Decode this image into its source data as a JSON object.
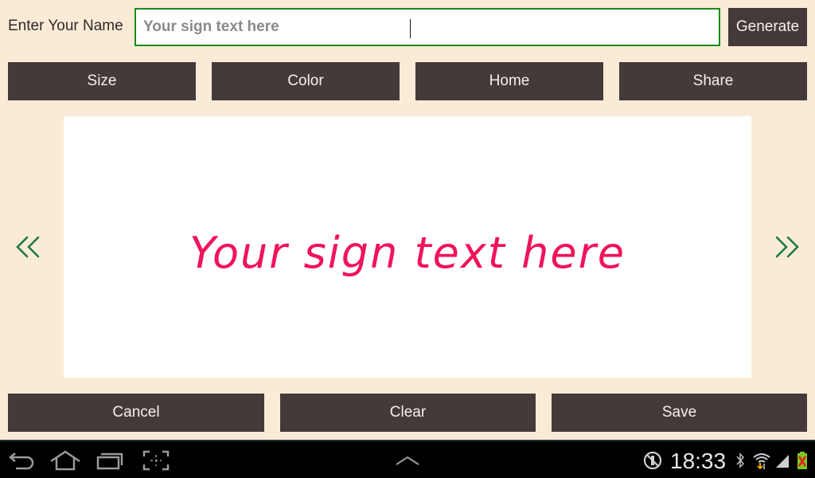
{
  "header": {
    "name_label": "Enter Your Name",
    "name_input_value": "Your sign text here",
    "name_input_placeholder": "Your sign text here",
    "generate_label": "Generate"
  },
  "toolbar": {
    "size_label": "Size",
    "color_label": "Color",
    "home_label": "Home",
    "share_label": "Share"
  },
  "preview": {
    "sign_text": "Your sign text here",
    "sign_color": "#f0145a",
    "prev_icon": "double-chevron-left",
    "next_icon": "double-chevron-right",
    "arrow_color": "#1a7a3a"
  },
  "actions": {
    "cancel_label": "Cancel",
    "clear_label": "Clear",
    "save_label": "Save"
  },
  "system_bar": {
    "back_icon": "back-arrow",
    "home_icon": "home-outline",
    "recents_icon": "recent-apps",
    "screenshot_icon": "screen-capture",
    "up_icon": "chevron-up",
    "clock": "18:33",
    "status_icons": [
      "no-sync",
      "bluetooth",
      "wifi",
      "signal",
      "battery-low"
    ]
  },
  "colors": {
    "background": "#faebd7",
    "button": "#453a3a",
    "button_text": "#f5f0ec",
    "input_border": "#1a8a1a"
  }
}
